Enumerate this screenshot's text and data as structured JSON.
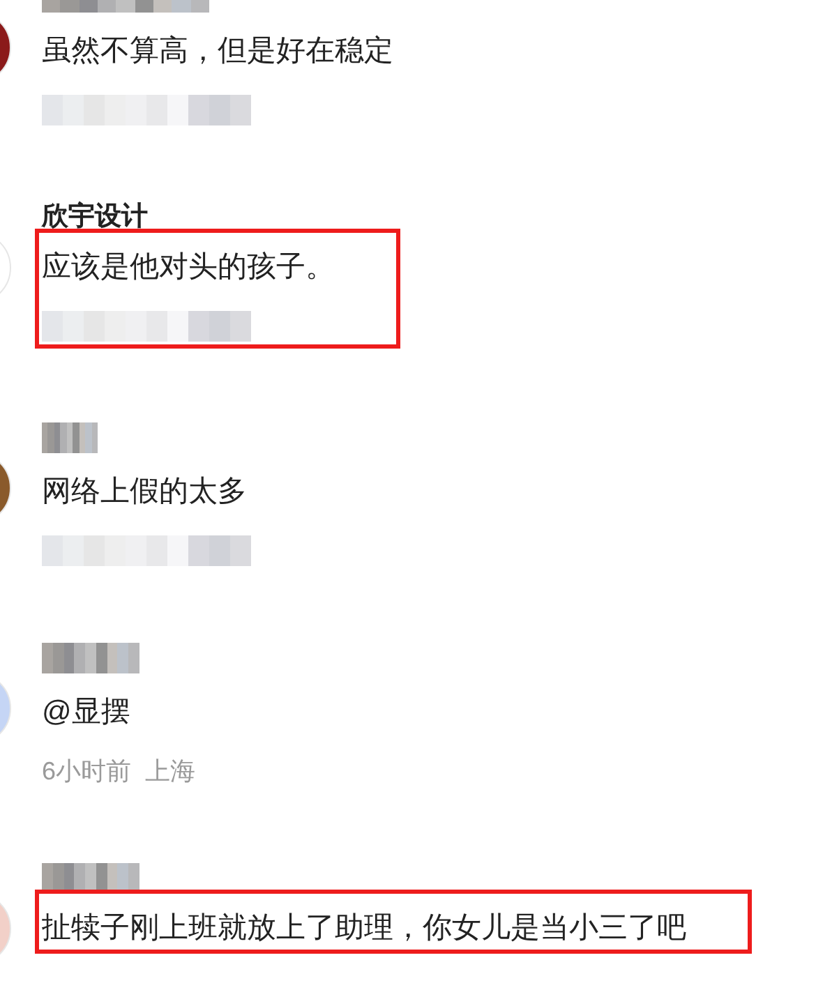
{
  "comments": [
    {
      "color": "#8b1a1a",
      "text": "虽然不算高，但是好在稳定",
      "highlighted": false
    },
    {
      "color": "#ffffff",
      "name": "欣宇设计",
      "text": "应该是他对头的孩子。",
      "highlighted": true
    },
    {
      "color": "#8a5a2b",
      "text": "网络上假的太多",
      "highlighted": false
    },
    {
      "color": "#c5d5f5",
      "text": "@显摆",
      "meta": "6小时前  上海",
      "highlighted": false
    },
    {
      "color": "#f2d0c8",
      "text": "扯犊子刚上班就放上了助理，你女儿是当小三了吧",
      "highlighted": true
    }
  ]
}
